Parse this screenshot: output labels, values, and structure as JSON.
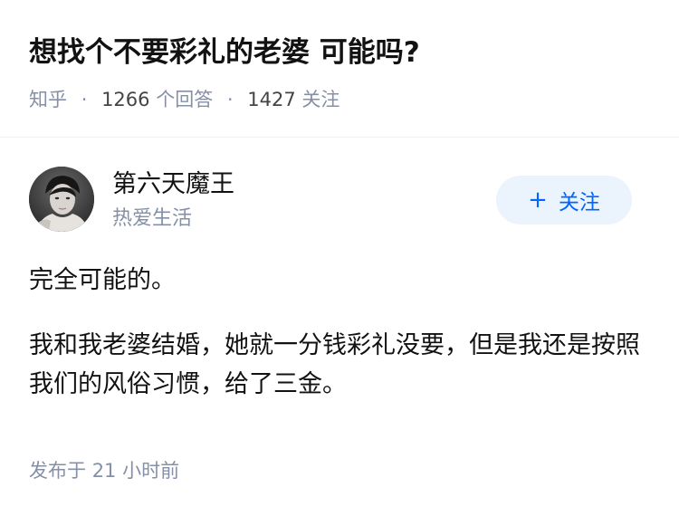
{
  "question": {
    "title": "想找个不要彩礼的老婆 可能吗?",
    "source": "知乎",
    "answer_count": "1266",
    "answer_label": "个回答",
    "follower_count": "1427",
    "follower_label": "关注",
    "separator": "·"
  },
  "author": {
    "name": "第六天魔王",
    "bio": "热爱生活",
    "follow_button": {
      "icon": "+",
      "label": "关注"
    }
  },
  "answer": {
    "paragraphs": [
      "完全可能的。",
      "我和我老婆结婚，她就一分钱彩礼没要，但是我还是按照我们的风俗习惯，给了三金。"
    ],
    "published_label": "发布于",
    "published_time": "21 小时前"
  },
  "colors": {
    "accent": "#0066ff",
    "follow_button_bg": "#ebf3fc",
    "meta_gray": "#8590a6"
  }
}
